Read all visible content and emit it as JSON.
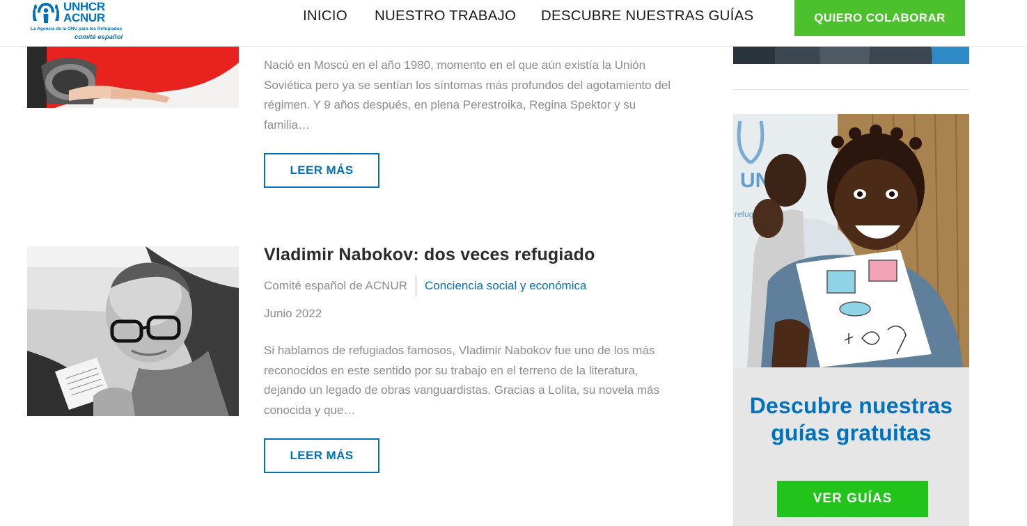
{
  "header": {
    "logo": {
      "line1": "UNHCR",
      "line2": "ACNUR",
      "tagline": "La Agencia de la ONU para los Refugiados",
      "subtitle": "comité español"
    },
    "nav": [
      "INICIO",
      "NUESTRO TRABAJO",
      "DESCUBRE NUESTRAS GUÍAS"
    ],
    "cta_label": "QUIERO COLABORAR"
  },
  "articles": [
    {
      "excerpt": "Nació en Moscú en el año 1980, momento en el que aún existía la Unión Soviética pero ya se sentían los síntomas más profundos del agotamiento del régimen. Y 9 años después, en plena Perestroika, Regina Spektor y su familia…",
      "read_more": "LEER MÁS",
      "image_icon": "woman-red-dress-photo"
    },
    {
      "title": "Vladimir Nabokov: dos veces refugiado",
      "author": "Comité español de ACNUR",
      "category": "Conciencia social y económica",
      "date": "Junio 2022",
      "excerpt": "Si hablamos de refugiados famosos, Vladimir Nabokov fue uno de los más reconocidos en este sentido por su trabajo en el terreno de la literatura, dejando un legado de obras vanguardistas. Gracias a Lolita, su novela más conocida y que…",
      "read_more": "LEER MÁS",
      "image_icon": "nabokov-bw-photo"
    }
  ],
  "sidebar": {
    "banner": {
      "headline": "Descubre nuestras guías gratuitas",
      "button_label": "VER GUÍAS",
      "image_icon": "smiling-child-with-drawing-photo"
    }
  },
  "colors": {
    "brand_blue": "#0072bc",
    "cta_green": "#4cc12d",
    "guides_green": "#22c31a",
    "excerpt_gray": "#8c8c8c"
  }
}
